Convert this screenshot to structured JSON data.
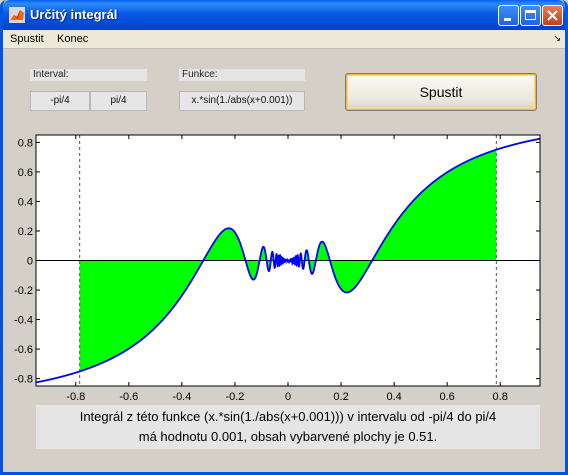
{
  "window": {
    "title": "Určitý integrál"
  },
  "menu": {
    "items": [
      "Spustit",
      "Konec"
    ],
    "dock_glyph": "↘"
  },
  "controls": {
    "interval_label": "Interval:",
    "interval_from": "-pi/4",
    "interval_to": "pi/4",
    "function_label": "Funkce:",
    "function_value": "x.*sin(1./abs(x+0.001))",
    "run_label": "Spustit"
  },
  "chart_data": {
    "type": "area",
    "function": "x.*sin(1./abs(x+0.001))",
    "xlim": [
      -0.95,
      0.95
    ],
    "ylim": [
      -0.85,
      0.85
    ],
    "interval": [
      -0.7854,
      0.7854
    ],
    "x_ticks": [
      -0.8,
      -0.6,
      -0.4,
      -0.2,
      0,
      0.2,
      0.4,
      0.6,
      0.8
    ],
    "y_ticks": [
      0.8,
      0.6,
      0.4,
      0.2,
      0,
      -0.2,
      -0.4,
      -0.6,
      -0.8
    ],
    "x_tick_labels": [
      "-0.8",
      "-0.6",
      "-0.4",
      "-0.2",
      "0",
      "0.2",
      "0.4",
      "0.6",
      "0.8"
    ],
    "y_tick_labels": [
      "0.8",
      "0.6",
      "0.4",
      "0.2",
      "0",
      "-0.2",
      "-0.4",
      "-0.6",
      "-0.8"
    ],
    "fill_color": "#00ff00",
    "line_color": "#0000ff"
  },
  "result": {
    "line1": "Integrál z této funkce (x.*sin(1./abs(x+0.001))) v intervalu od -pi/4 do pi/4",
    "line2": "má hodnotu 0.001, obsah vybarvené plochy je 0.51."
  },
  "colors": {
    "titlebar": "#0054e3",
    "close": "#c3401c",
    "fill": "#00ff00",
    "curve": "#0000ff"
  }
}
